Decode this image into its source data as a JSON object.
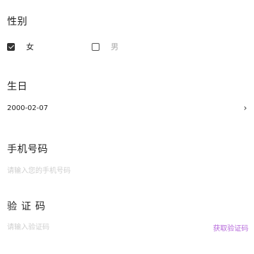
{
  "gender": {
    "label": "性别",
    "options": [
      {
        "label": "女",
        "checked": true
      },
      {
        "label": "男",
        "checked": false
      }
    ]
  },
  "birthday": {
    "label": "生日",
    "value": "2000-02-07",
    "chevron": "›",
    "icon": "chevron-right-icon"
  },
  "phone": {
    "label": "手机号码",
    "placeholder": "请输入您的手机号码",
    "value": ""
  },
  "code": {
    "label": "验证码",
    "placeholder": "请输入验证码",
    "value": "",
    "get_code_label": "获取验证码",
    "get_code_color": "#b76bdb"
  }
}
